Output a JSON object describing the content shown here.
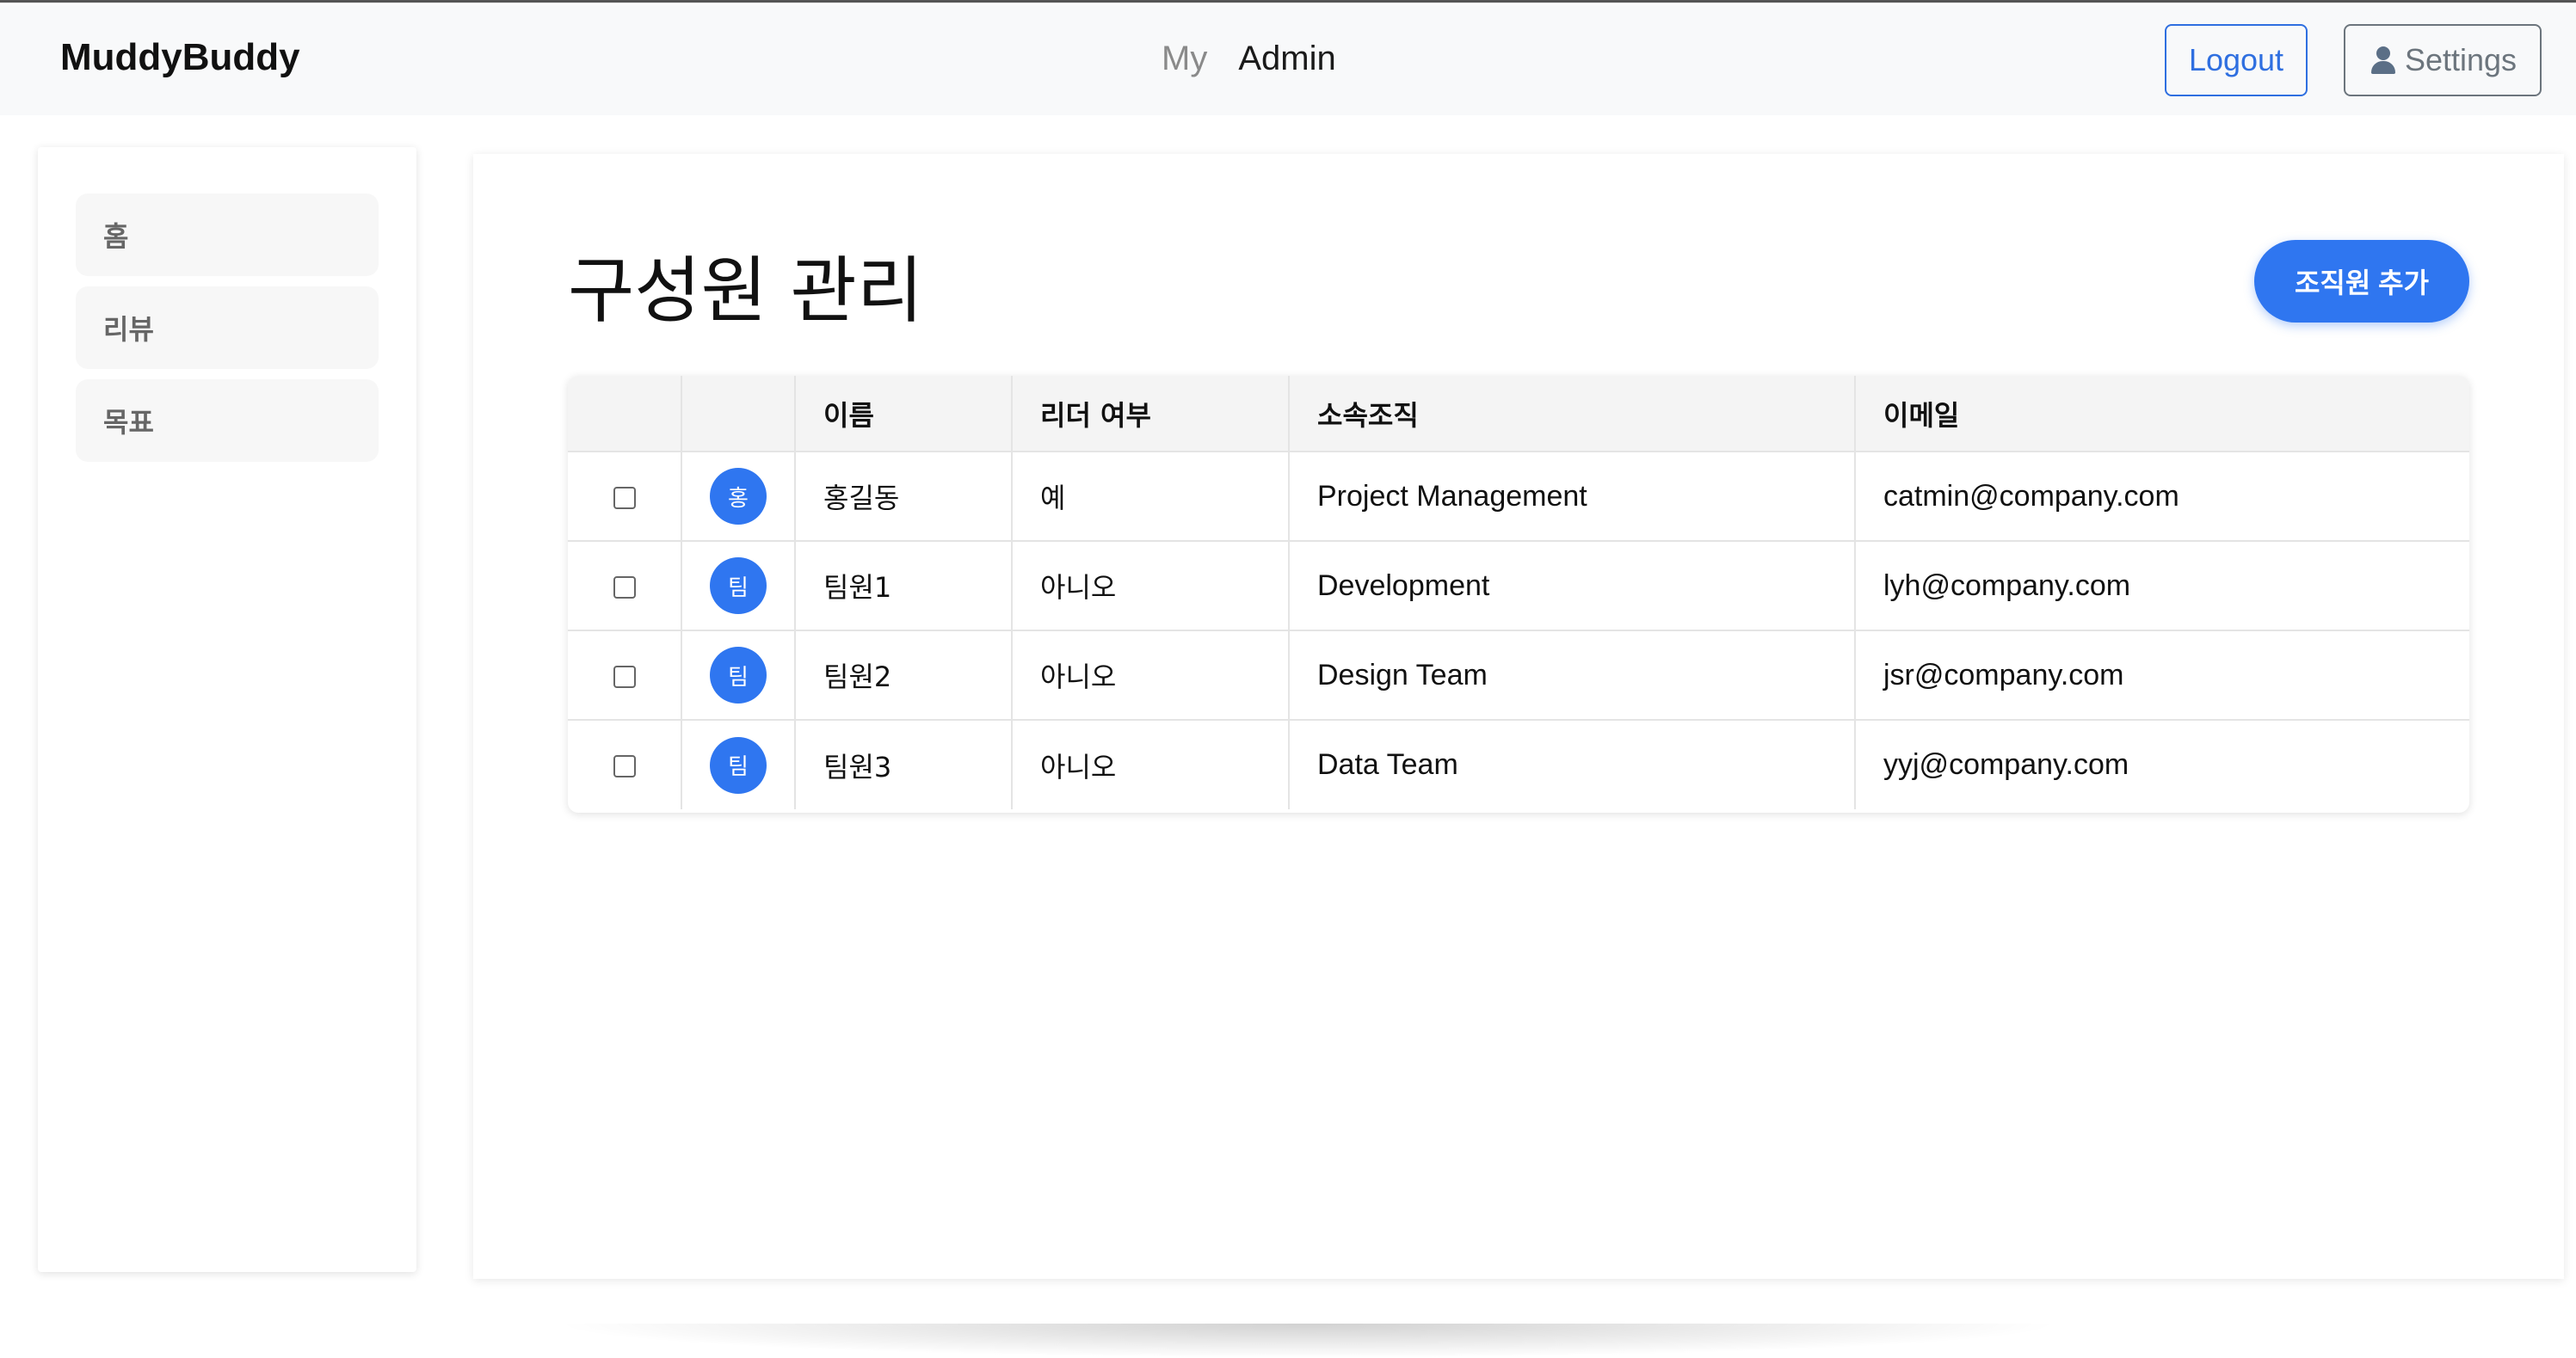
{
  "header": {
    "brand": "MuddyBuddy",
    "nav": [
      {
        "label": "My",
        "active": false
      },
      {
        "label": "Admin",
        "active": true
      }
    ],
    "logout_label": "Logout",
    "settings_label": "Settings",
    "settings_icon": "user-icon"
  },
  "sidebar": {
    "items": [
      {
        "label": "홈"
      },
      {
        "label": "리뷰"
      },
      {
        "label": "목표"
      }
    ]
  },
  "main": {
    "title": "구성원 관리",
    "add_button_label": "조직원 추가",
    "table": {
      "headers": [
        "",
        "",
        "이름",
        "리더 여부",
        "소속조직",
        "이메일"
      ],
      "rows": [
        {
          "avatar": "홍",
          "name": "홍길동",
          "leader": "예",
          "org": "Project Management",
          "email": "catmin@company.com"
        },
        {
          "avatar": "팀",
          "name": "팀원1",
          "leader": "아니오",
          "org": "Development",
          "email": "lyh@company.com"
        },
        {
          "avatar": "팀",
          "name": "팀원2",
          "leader": "아니오",
          "org": "Design Team",
          "email": "jsr@company.com"
        },
        {
          "avatar": "팀",
          "name": "팀원3",
          "leader": "아니오",
          "org": "Data Team",
          "email": "yyj@company.com"
        }
      ]
    }
  },
  "colors": {
    "accent": "#2f76f0",
    "topbar_bg": "#f8f9fa",
    "logout": "#2f6fe0",
    "settings": "#6c757d"
  }
}
